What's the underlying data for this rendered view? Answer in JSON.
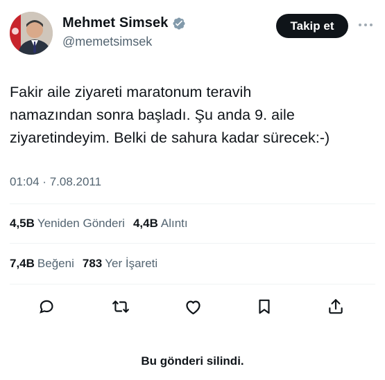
{
  "author": {
    "display_name": "Mehmet Simsek",
    "handle": "@memetsimsek",
    "verified": true,
    "avatar_icon": "profile-photo"
  },
  "header": {
    "follow_label": "Takip et",
    "more_icon": "more-horizontal-icon"
  },
  "tweet": {
    "text": "Fakir aile ziyareti maratonum teravih\nnamazından sonra başladı. Şu anda 9. aile\nziyaretindeyim. Belki de sahura kadar sürecek:-)",
    "time": "01:04",
    "separator": "·",
    "date": "7.08.2011"
  },
  "stats": {
    "reposts": {
      "value": "4,5B",
      "label": "Yeniden Gönderi"
    },
    "quotes": {
      "value": "4,4B",
      "label": "Alıntı"
    },
    "likes": {
      "value": "7,4B",
      "label": "Beğeni"
    },
    "bookmarks": {
      "value": "783",
      "label": "Yer İşareti"
    }
  },
  "actions": [
    {
      "name": "reply",
      "icon": "comment-icon"
    },
    {
      "name": "repost",
      "icon": "repost-icon"
    },
    {
      "name": "like",
      "icon": "heart-icon"
    },
    {
      "name": "bookmark",
      "icon": "bookmark-icon"
    },
    {
      "name": "share",
      "icon": "share-icon"
    }
  ],
  "notice": {
    "deleted_text": "Bu gönderi silindi."
  },
  "colors": {
    "text_primary": "#0f1419",
    "text_secondary": "#536471",
    "verified_badge": "#829aab",
    "divider": "#eff3f4",
    "follow_button_bg": "#0f1419"
  }
}
